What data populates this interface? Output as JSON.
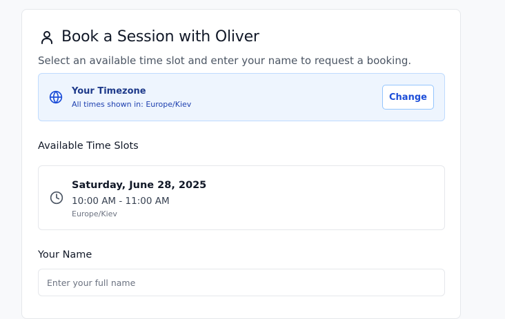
{
  "header": {
    "title": "Book a Session with Oliver",
    "subtitle": "Select an available time slot and enter your name to request a booking.",
    "icon": "user-icon"
  },
  "timezone": {
    "title": "Your Timezone",
    "description": "All times shown in: Europe/Kiev",
    "change_label": "Change",
    "icon": "globe-icon"
  },
  "slots": {
    "heading": "Available Time Slots",
    "items": [
      {
        "date": "Saturday, June 28, 2025",
        "time": "10:00 AM - 11:00 AM",
        "timezone": "Europe/Kiev",
        "icon": "clock-icon"
      }
    ]
  },
  "name_field": {
    "label": "Your Name",
    "placeholder": "Enter your full name",
    "value": ""
  },
  "colors": {
    "accent": "#1d4ed8",
    "info_bg": "#eef5fe",
    "info_border": "#bfdbfe"
  }
}
